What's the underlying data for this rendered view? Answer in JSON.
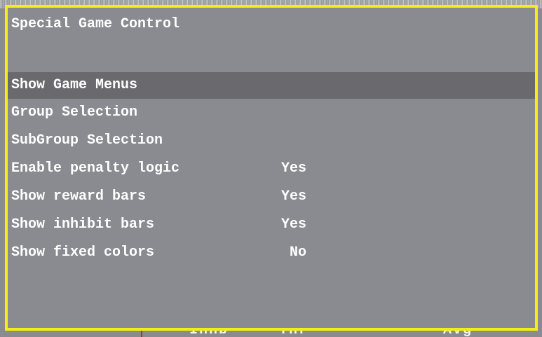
{
  "panel": {
    "title": "Special Game Control",
    "items": [
      {
        "label": "Show Game Menus",
        "value": "",
        "selected": true
      },
      {
        "label": "Group Selection",
        "value": ""
      },
      {
        "label": "SubGroup Selection",
        "value": ""
      },
      {
        "label": "Enable penalty logic",
        "value": "Yes"
      },
      {
        "label": "Show reward bars",
        "value": "Yes"
      },
      {
        "label": "Show inhibit bars",
        "value": "Yes"
      },
      {
        "label": "Show fixed colors",
        "value": "No"
      }
    ]
  },
  "background": {
    "bottom_labels": [
      "Inhb",
      "Thr",
      "Avg"
    ]
  },
  "colors": {
    "panel_background": "#8a8b90",
    "selected_row": "#69696e",
    "border": "#f4ee18",
    "text": "#ffffff"
  }
}
